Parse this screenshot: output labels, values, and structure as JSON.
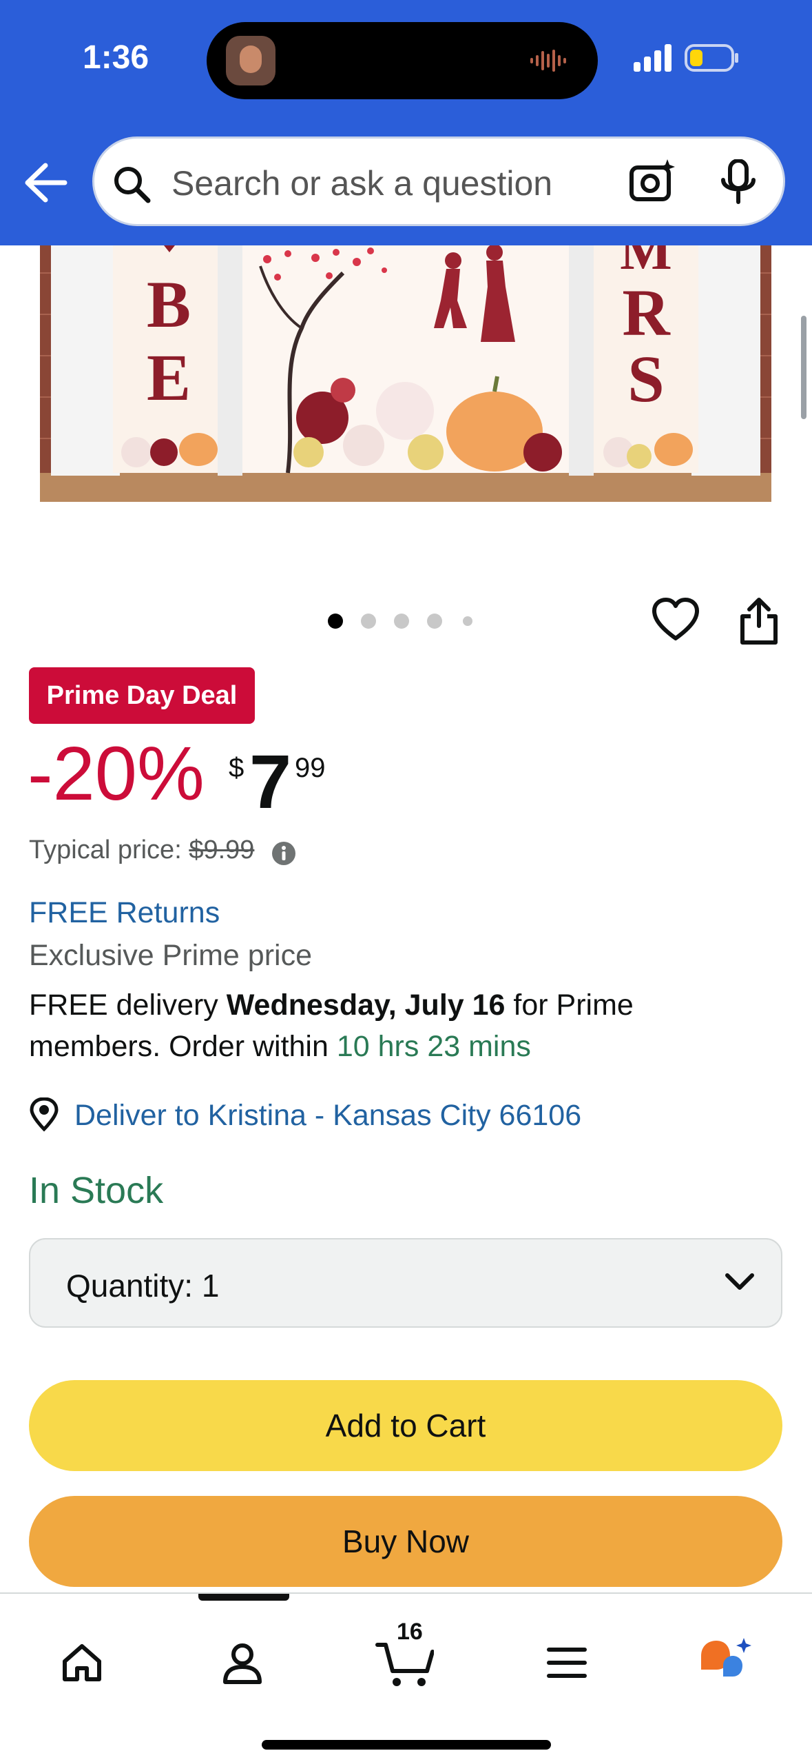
{
  "status_bar": {
    "time": "1:36",
    "battery_color": "#ffd60a"
  },
  "header": {
    "background": "#2b5ed9",
    "search": {
      "placeholder": "Search or ask a question"
    }
  },
  "product_image": {
    "left_sign_letters": [
      "B",
      "E"
    ],
    "right_sign_letters": [
      "M",
      "R",
      "S"
    ]
  },
  "carousel": {
    "dots": 5,
    "active_index": 0
  },
  "deal": {
    "badge": "Prime Day Deal",
    "discount": "-20%",
    "price_symbol": "$",
    "price_whole": "7",
    "price_fraction": "99",
    "typical_label": "Typical price:",
    "typical_value": "$9.99"
  },
  "returns": "FREE Returns",
  "prime_price": "Exclusive Prime price",
  "delivery": {
    "prefix": "FREE delivery",
    "date": "Wednesday, July 16",
    "suffix": "for Prime members. Order within",
    "countdown": "10 hrs 23 mins"
  },
  "deliver_to": "Deliver to Kristina - Kansas City 66106",
  "stock": "In Stock",
  "quantity": {
    "label": "Quantity:",
    "value": "1"
  },
  "buttons": {
    "add_to_cart": "Add to Cart",
    "buy_now": "Buy Now"
  },
  "bottom_nav": {
    "items": [
      "home-icon",
      "account-icon",
      "cart-icon",
      "menu-icon",
      "rufus-icon"
    ],
    "cart_count": "16"
  },
  "colors": {
    "deal_red": "#cc0c39",
    "link_blue": "#2162a1",
    "stock_green": "#2a7a55",
    "add_to_cart": "#f8d94a",
    "buy_now": "#f0a840"
  }
}
